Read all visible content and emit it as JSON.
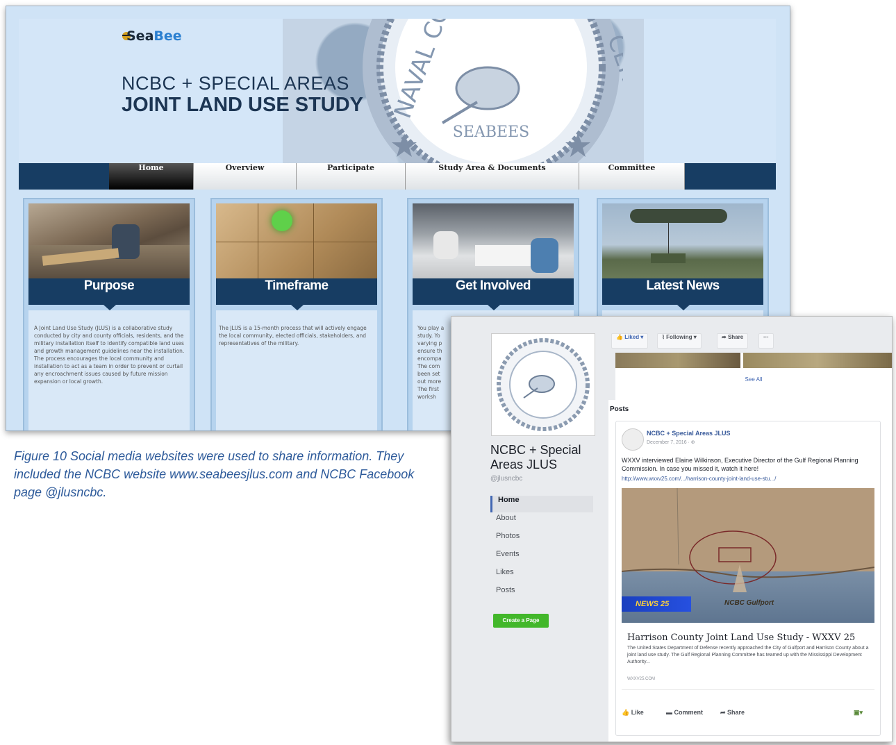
{
  "website": {
    "logo": {
      "part1": "Sea",
      "part2": "Bee"
    },
    "title_line1": "NCBC + SPECIAL AREAS",
    "title_line2": "JOINT LAND USE STUDY",
    "seal": {
      "arc_left": "NAVAL CO",
      "arc_right": "CENTER",
      "center": "SEABEES"
    },
    "nav": [
      "Home",
      "Overview",
      "Participate",
      "Study Area & Documents",
      "Committee"
    ],
    "cards": [
      {
        "title": "Purpose",
        "text": "A Joint Land Use Study (JLUS) is a collaborative study conducted by city and county officials, residents, and the military installation itself to identify compatible land uses and growth management guidelines near the installation. The process encourages the local community and installation to act as a team in order to prevent or curtail any encroachment issues caused by future mission expansion or local growth."
      },
      {
        "title": "Timeframe",
        "text": "The JLUS is a 15-month process that will actively engage the local community, elected officials, stakeholders, and representatives of the military."
      },
      {
        "title": "Get Involved",
        "text": "You play a study. Yo varying p ensure th encompa The com been set out more The first worksh"
      },
      {
        "title": "Latest News",
        "text": ""
      }
    ]
  },
  "caption": "Figure 10 Social media websites were used to share information. They included the NCBC website www.seabeesjlus.com and NCBC Facebook page @jlusncbc.",
  "facebook": {
    "page_name": "NCBC + Special Areas JLUS",
    "handle": "@jlusncbc",
    "nav": [
      "Home",
      "About",
      "Photos",
      "Events",
      "Likes",
      "Posts"
    ],
    "create_button": "Create a Page",
    "actions": {
      "liked": "Liked ▾",
      "following": "Following ▾",
      "share": "Share",
      "more": "···"
    },
    "see_all": "See All",
    "posts_label": "Posts",
    "post": {
      "author": "NCBC + Special Areas JLUS",
      "date": "December 7, 2016 · ⊕",
      "text": "WXXV interviewed Elaine Wilkinson, Executive Director of the Gulf Regional Planning Commission. In case you missed it, watch it here!",
      "link": "http://www.wxxv25.com/.../harrison-county-joint-land-use-stu.../",
      "image_label": "NCBC Gulfport",
      "image_logo": "NEWS 25",
      "link_title": "Harrison County Joint Land Use Study - WXXV 25",
      "link_desc": "The United States Department of Defense recently approached the City of Gulfport and Harrison County about a joint land use study. The Gulf Regional Planning Committee has teamed up with the Mississippi Development Authority...",
      "link_domain": "WXXV25.COM",
      "like": "Like",
      "comment": "Comment",
      "share": "Share"
    }
  },
  "colors": {
    "navy": "#173d63",
    "banner": "#d4e6f8",
    "fb_green": "#42b72a",
    "fb_link": "#365899",
    "caption": "#2d5a9a"
  }
}
